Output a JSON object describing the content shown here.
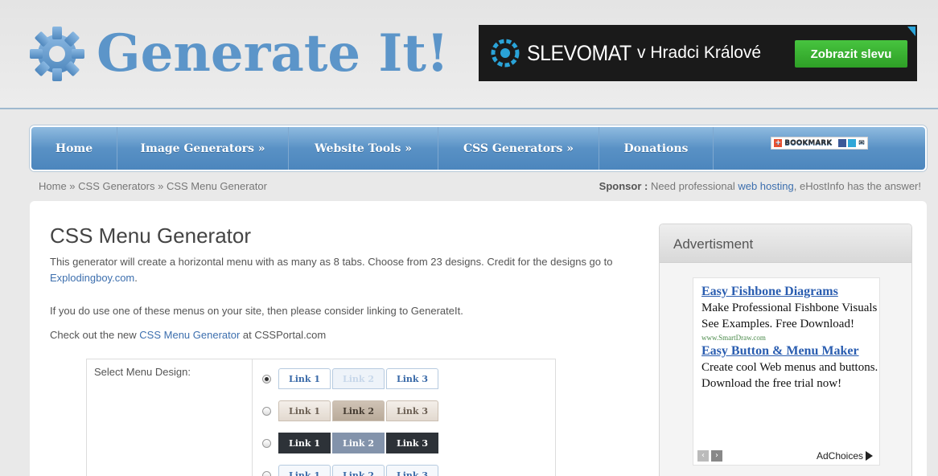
{
  "header": {
    "logo_text": "Generate It!",
    "ad": {
      "brand": "SLEVOMAT",
      "place": "v Hradci Králové",
      "cta": "Zobrazit slevu"
    }
  },
  "nav": {
    "items": [
      {
        "label": "Home"
      },
      {
        "label": "Image Generators »"
      },
      {
        "label": "Website Tools »"
      },
      {
        "label": "CSS Generators »"
      },
      {
        "label": "Donations"
      }
    ],
    "bookmark_label": "BOOKMARK"
  },
  "breadcrumb": {
    "text": "Home » CSS Generators » CSS Menu Generator"
  },
  "sponsor": {
    "prefix": "Sponsor :",
    "text_before": " Need professional ",
    "link": "web hosting",
    "text_after": ", eHostInfo has the answer!"
  },
  "main": {
    "title": "CSS Menu Generator",
    "intro_before": "This generator will create a horizontal menu with as many as 8 tabs. Choose from 23 designs. Credit for the designs go to ",
    "intro_link": "Explodingboy.com",
    "intro_after": ".",
    "note1": "If you do use one of these menus on your site, then please consider linking to GenerateIt.",
    "note2_before": "Check out the new ",
    "note2_link": "CSS Menu Generator",
    "note2_after": " at CSSPortal.com",
    "select_label": "Select Menu Design:",
    "designs": [
      {
        "tabs": [
          "Link 1",
          "Link 2",
          "Link 3"
        ],
        "selected": true
      },
      {
        "tabs": [
          "Link 1",
          "Link 2",
          "Link 3"
        ],
        "selected": false
      },
      {
        "tabs": [
          "Link 1",
          "Link 2",
          "Link 3"
        ],
        "selected": false
      },
      {
        "tabs": [
          "Link 1",
          "Link 2",
          "Link 3"
        ],
        "selected": false
      }
    ]
  },
  "sidebar": {
    "heading": "Advertisment",
    "ads": [
      {
        "title": "Easy Fishbone Diagrams",
        "body": "Make Professional Fishbone Visuals See Examples. Free Download!",
        "url": "www.SmartDraw.com"
      },
      {
        "title": "Easy Button & Menu Maker",
        "body": "Create cool Web menus and buttons. Download the free trial now!"
      }
    ],
    "adchoices": "AdChoices"
  }
}
